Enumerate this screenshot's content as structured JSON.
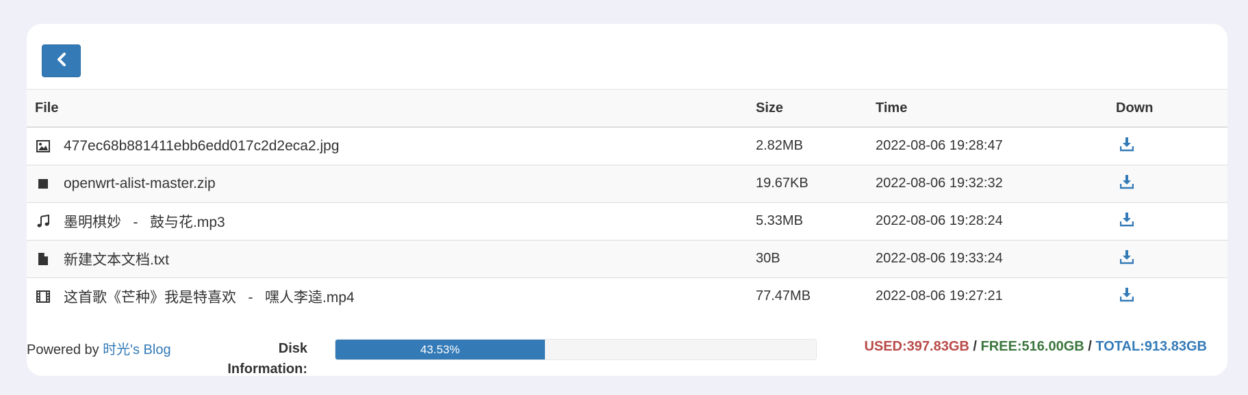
{
  "toolbar": {
    "back_icon": "chevron-left-icon"
  },
  "table": {
    "headers": {
      "file": "File",
      "size": "Size",
      "time": "Time",
      "down": "Down"
    },
    "rows": [
      {
        "icon": "image-icon",
        "name": "477ec68b881411ebb6edd017c2d2eca2.jpg",
        "size": "2.82MB",
        "time": "2022-08-06 19:28:47"
      },
      {
        "icon": "archive-icon",
        "name": "openwrt-alist-master.zip",
        "size": "19.67KB",
        "time": "2022-08-06 19:32:32"
      },
      {
        "icon": "music-icon",
        "name": "墨明棋妙   -   鼓与花.mp3",
        "size": "5.33MB",
        "time": "2022-08-06 19:28:24"
      },
      {
        "icon": "file-icon",
        "name": "新建文本文档.txt",
        "size": "30B",
        "time": "2022-08-06 19:33:24"
      },
      {
        "icon": "film-icon",
        "name": "这首歌《芒种》我是特喜欢   -   嘿人李逵.mp4",
        "size": "77.47MB",
        "time": "2022-08-06 19:27:21"
      }
    ]
  },
  "footer": {
    "powered_prefix": "Powered by ",
    "powered_link": "时光's Blog",
    "disk_label": "Disk Information:",
    "disk_percent_text": "43.53%",
    "disk_fraction": 0.4353,
    "used": "USED:397.83GB",
    "free": "FREE:516.00GB",
    "total": "TOTAL:913.83GB",
    "separator": " / "
  },
  "colors": {
    "accent": "#337ab7",
    "used": "#b94a48",
    "free": "#3c763d",
    "background": "#f0f1f8"
  }
}
